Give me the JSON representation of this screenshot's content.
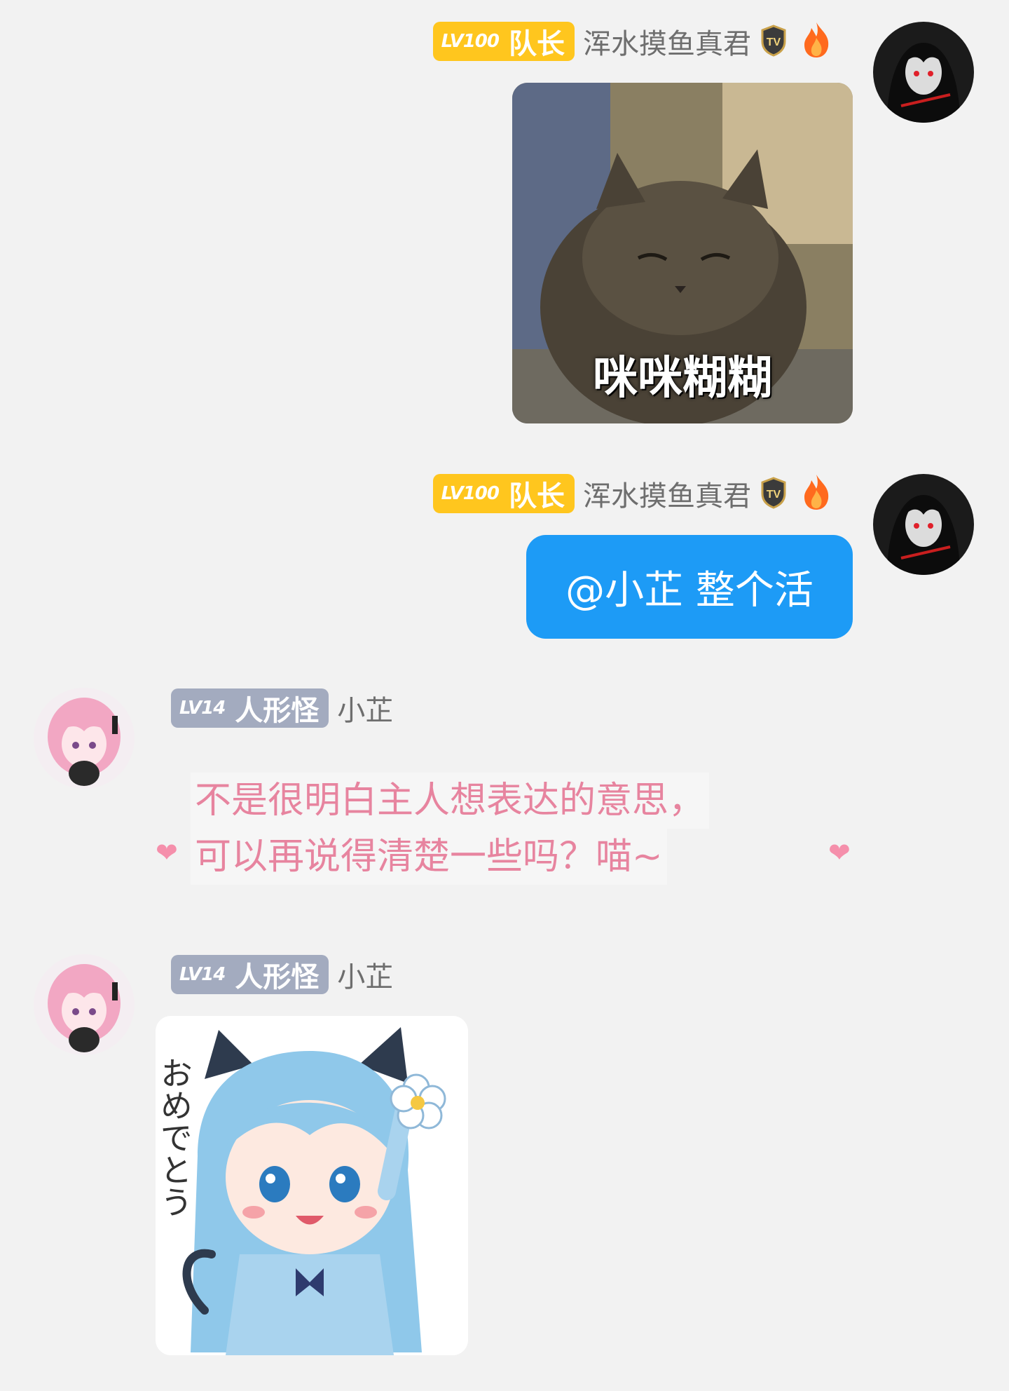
{
  "messages": [
    {
      "side": "right",
      "badge": {
        "level": "LV100",
        "title": "队长"
      },
      "username": "浑水摸鱼真君",
      "type": "image",
      "image_caption": "咪咪糊糊"
    },
    {
      "side": "right",
      "badge": {
        "level": "LV100",
        "title": "队长"
      },
      "username": "浑水摸鱼真君",
      "type": "text",
      "text": "@小芷 整个活"
    },
    {
      "side": "left",
      "badge": {
        "level": "LV14",
        "title": "人形怪"
      },
      "username": "小芷",
      "type": "styled-text",
      "lines": [
        "不是很明白主人想表达的意思，",
        "可以再说得清楚一些吗？喵~"
      ]
    },
    {
      "side": "left",
      "badge": {
        "level": "LV14",
        "title": "人形怪"
      },
      "username": "小芷",
      "type": "image",
      "image_caption": "おめでとう"
    }
  ],
  "colors": {
    "background": "#f2f2f2",
    "badge_gold": "#ffc61e",
    "badge_gray": "#a3abbf",
    "bubble_blue": "#1d9bf6",
    "cute_text_pink": "#e7849f"
  },
  "icons": [
    "tv-icon",
    "fire-icon",
    "heart-icon"
  ]
}
